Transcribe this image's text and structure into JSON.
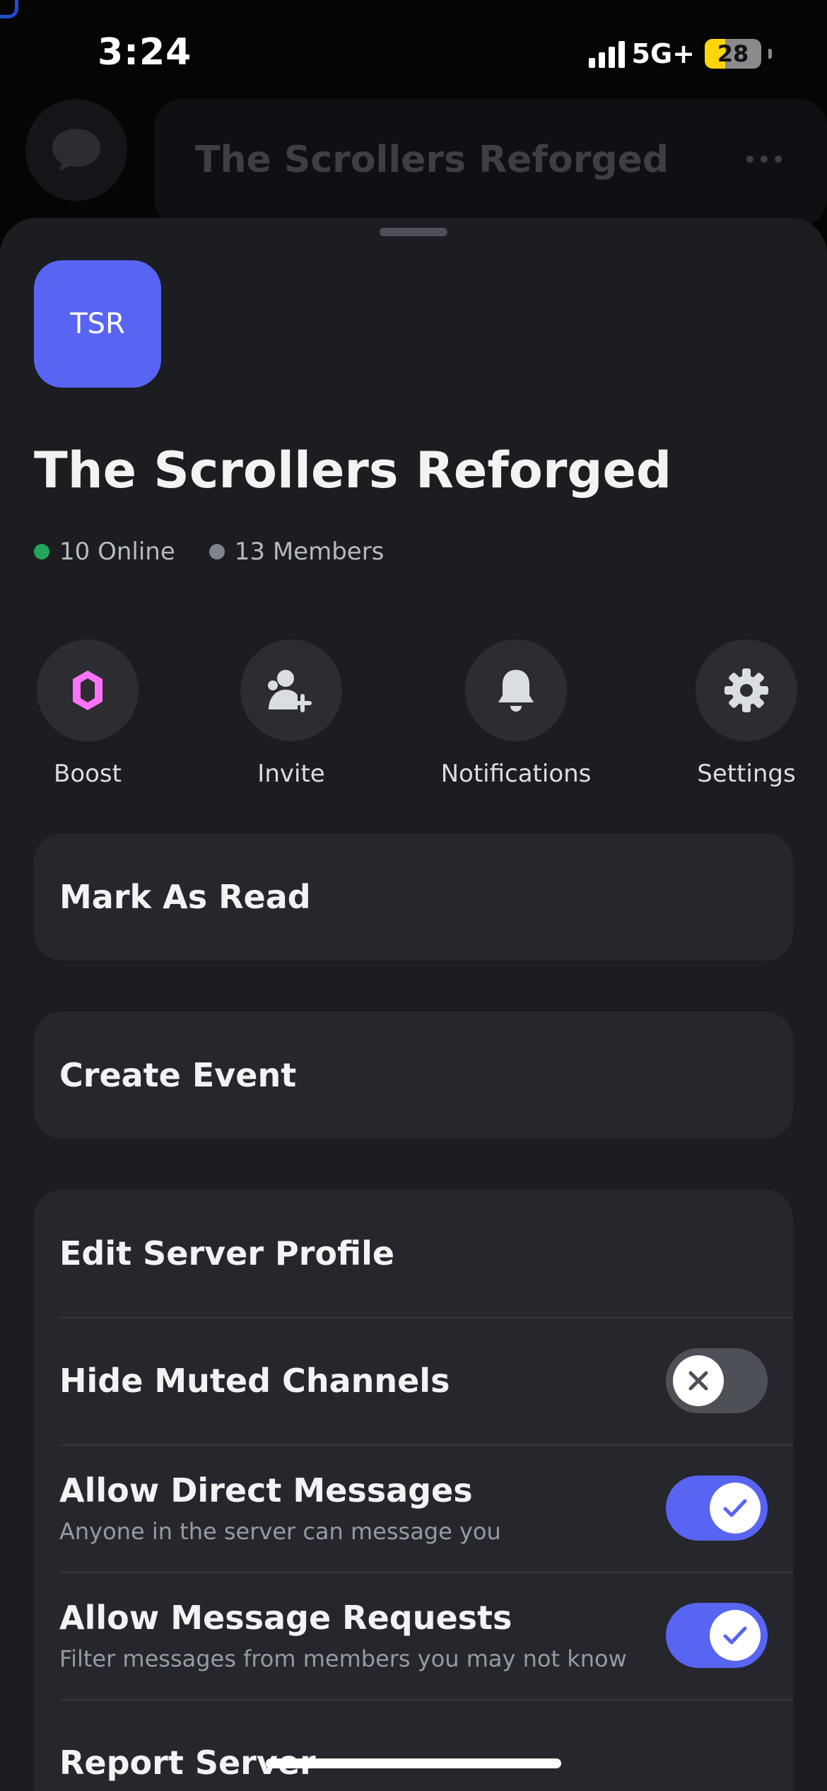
{
  "status_bar": {
    "time": "3:24",
    "network": "5G+",
    "battery": "28"
  },
  "background": {
    "header_title": "The Scrollers Reforged"
  },
  "server": {
    "icon_initials": "TSR",
    "icon_color": "#5865f2",
    "name": "The Scrollers Reforged",
    "online": "10 Online",
    "members": "13 Members",
    "online_color": "#23a55a",
    "members_color": "#80848e"
  },
  "actions": [
    {
      "label": "Boost",
      "icon": "boost-gem-icon"
    },
    {
      "label": "Invite",
      "icon": "invite-person-icon"
    },
    {
      "label": "Notifications",
      "icon": "bell-icon"
    },
    {
      "label": "Settings",
      "icon": "gear-icon"
    }
  ],
  "menu": {
    "mark_as_read": "Mark As Read",
    "create_event": "Create Event",
    "edit_server_profile": "Edit Server Profile",
    "hide_muted_channels": {
      "label": "Hide Muted Channels",
      "enabled": false
    },
    "allow_direct_messages": {
      "label": "Allow Direct Messages",
      "description": "Anyone in the server can message you",
      "enabled": true
    },
    "allow_message_requests": {
      "label": "Allow Message Requests",
      "description": "Filter messages from members you may not know",
      "enabled": true
    },
    "report_server": "Report Server"
  },
  "colors": {
    "accent": "#5865f2",
    "boost_pink": "#ff73fa",
    "sheet_bg": "#1c1d21",
    "card_bg": "#26272d"
  }
}
